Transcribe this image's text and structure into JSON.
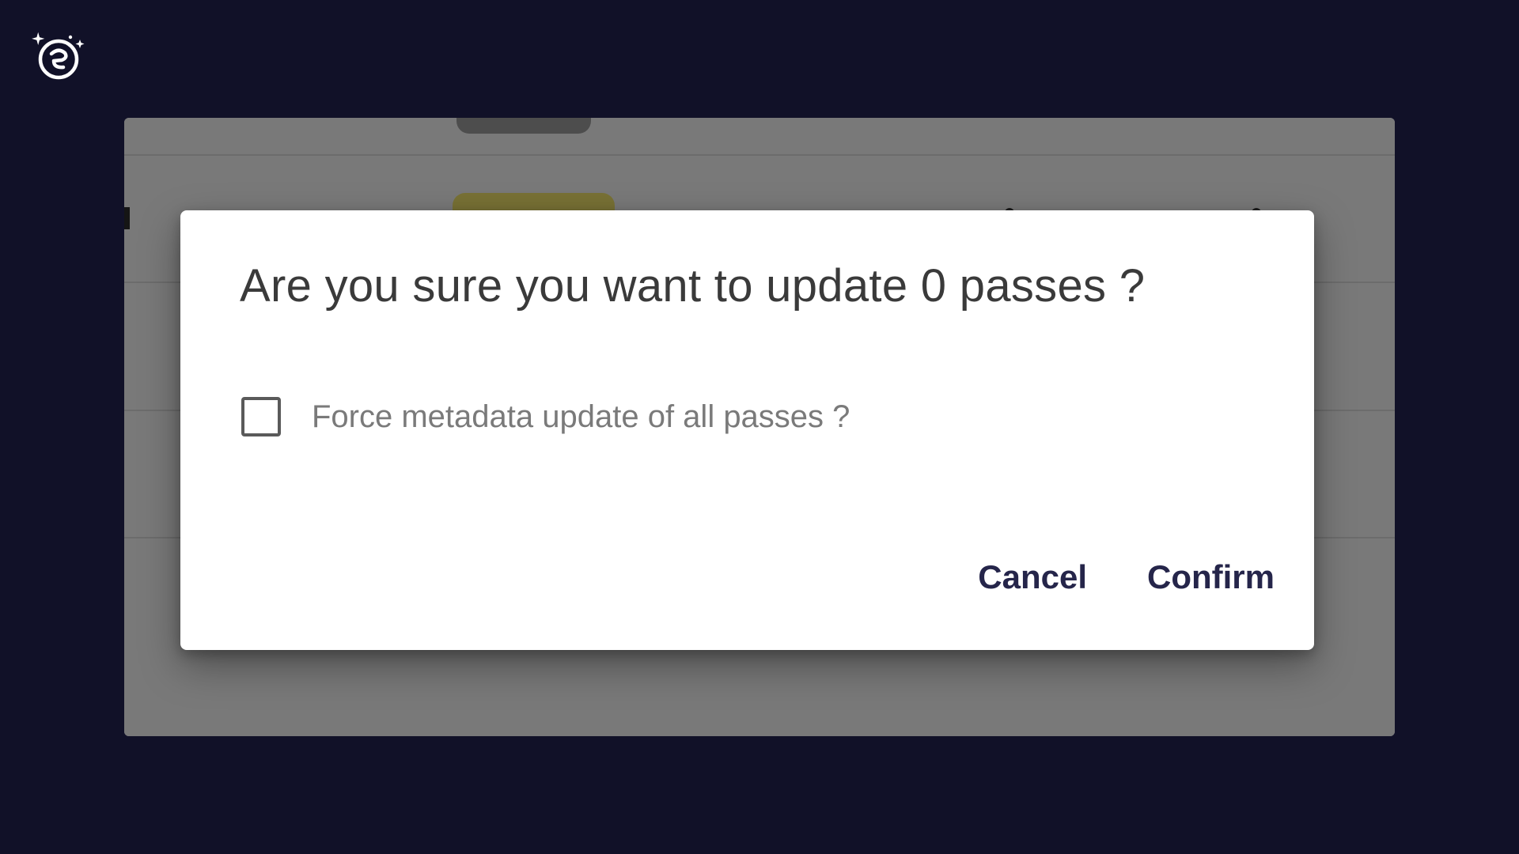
{
  "brand": {
    "logo_icon": "sparkle-e-logo-icon"
  },
  "dialog": {
    "title": "Are you sure you want to update 0 passes ?",
    "checkbox": {
      "label": "Force metadata update of all passes ?",
      "checked": false
    },
    "buttons": {
      "cancel_label": "Cancel",
      "confirm_label": "Confirm"
    }
  },
  "colors": {
    "page_background": "#111128",
    "button_text": "#25254a",
    "dialog_background": "#ffffff"
  }
}
